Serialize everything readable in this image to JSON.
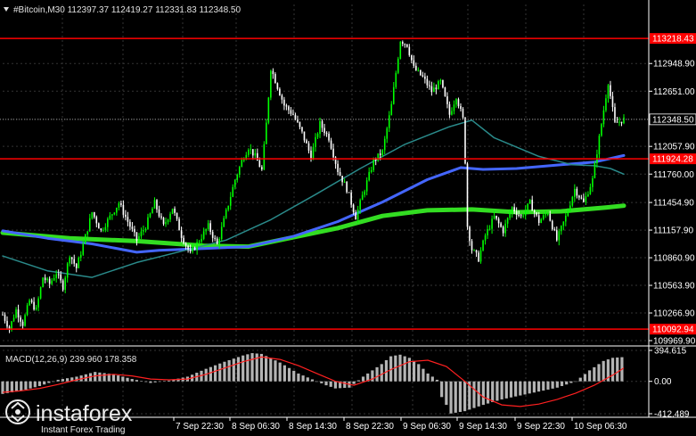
{
  "header": {
    "main_label": "#Bitcoin,M30  112397.37 112419.27 112331.83 112348.50",
    "macd_label": "MACD(12,26,9) 239.960 178.358"
  },
  "watermark": {
    "brand": "instaforex",
    "tagline": "Instant Forex Trading"
  },
  "colors": {
    "background": "#000000",
    "grid": "#343434",
    "bull": "#00ff00",
    "bear": "#ffffff",
    "hline": "#ff0000",
    "ma_slow": "#33dd22",
    "ma_mid": "#4466ff",
    "ma_fast": "#2a8a8a",
    "macd_hist": "#b4b4b4",
    "macd_signal": "#ff2020",
    "current_label_bg": "#000000"
  },
  "chart_data": [
    {
      "type": "candlestick",
      "symbol": "#Bitcoin",
      "timeframe": "M30",
      "ylim": [
        109969.9,
        113440
      ],
      "y_ticks": [
        112948.9,
        112651.0,
        112348.5,
        112057.9,
        111760.0,
        111454.9,
        111157.9,
        110860.9,
        110563.9,
        110266.9,
        109969.9
      ],
      "y_tick_labels": [
        "112948.90",
        "112651.00",
        "112348.50",
        "112057.90",
        "111760.00",
        "111454.90",
        "111157.90",
        "110860.90",
        "110563.90",
        "110266.90",
        "109969.90"
      ],
      "x_tick_labels": [
        "7 Sep 22:30",
        "8 Sep 06:30",
        "8 Sep 14:30",
        "8 Sep 22:30",
        "9 Sep 06:30",
        "9 Sep 14:30",
        "9 Sep 22:30",
        "10 Sep 06:30"
      ],
      "horizontal_lines": [
        {
          "value": 113218.43,
          "label": "113218.43"
        },
        {
          "value": 111924.28,
          "label": "111924.28"
        },
        {
          "value": 110092.94,
          "label": "110092.94"
        }
      ],
      "current_price": {
        "value": 112348.5,
        "label": "112348.50"
      },
      "price_path": [
        [
          0,
          110250
        ],
        [
          3,
          110100
        ],
        [
          6,
          110300
        ],
        [
          9,
          110150
        ],
        [
          12,
          110400
        ],
        [
          15,
          110300
        ],
        [
          18,
          110650
        ],
        [
          21,
          110580
        ],
        [
          24,
          110700
        ],
        [
          27,
          110550
        ],
        [
          30,
          110900
        ],
        [
          33,
          110750
        ],
        [
          36,
          111000
        ],
        [
          40,
          111350
        ],
        [
          44,
          111150
        ],
        [
          48,
          111300
        ],
        [
          52,
          111450
        ],
        [
          56,
          111250
        ],
        [
          60,
          111050
        ],
        [
          64,
          111200
        ],
        [
          68,
          111450
        ],
        [
          72,
          111200
        ],
        [
          76,
          111400
        ],
        [
          80,
          111100
        ],
        [
          84,
          110900
        ],
        [
          88,
          111050
        ],
        [
          92,
          111200
        ],
        [
          96,
          111000
        ],
        [
          100,
          111350
        ],
        [
          104,
          111700
        ],
        [
          107,
          111900
        ],
        [
          110,
          112050
        ],
        [
          113,
          111950
        ],
        [
          116,
          111800
        ],
        [
          118,
          112300
        ],
        [
          120,
          112900
        ],
        [
          123,
          112700
        ],
        [
          126,
          112500
        ],
        [
          130,
          112400
        ],
        [
          134,
          112200
        ],
        [
          138,
          111950
        ],
        [
          142,
          112300
        ],
        [
          146,
          112150
        ],
        [
          150,
          111800
        ],
        [
          154,
          111600
        ],
        [
          158,
          111300
        ],
        [
          162,
          111600
        ],
        [
          166,
          111900
        ],
        [
          170,
          112000
        ],
        [
          174,
          112500
        ],
        [
          178,
          113200
        ],
        [
          181,
          113150
        ],
        [
          184,
          112900
        ],
        [
          188,
          112800
        ],
        [
          192,
          112650
        ],
        [
          196,
          112750
        ],
        [
          200,
          112400
        ],
        [
          203,
          112600
        ],
        [
          206,
          112350
        ],
        [
          207,
          111900
        ],
        [
          208,
          111200
        ],
        [
          210,
          110950
        ],
        [
          213,
          110850
        ],
        [
          216,
          111100
        ],
        [
          220,
          111300
        ],
        [
          224,
          111150
        ],
        [
          228,
          111400
        ],
        [
          232,
          111300
        ],
        [
          236,
          111450
        ],
        [
          240,
          111250
        ],
        [
          244,
          111350
        ],
        [
          248,
          111050
        ],
        [
          252,
          111300
        ],
        [
          256,
          111600
        ],
        [
          260,
          111450
        ],
        [
          264,
          111700
        ],
        [
          268,
          112300
        ],
        [
          271,
          112750
        ],
        [
          274,
          112300
        ],
        [
          278,
          112350
        ]
      ],
      "series": [
        {
          "values": [
            [
              0,
              111130
            ],
            [
              30,
              111070
            ],
            [
              60,
              111040
            ],
            [
              90,
              110990
            ],
            [
              110,
              110980
            ],
            [
              130,
              111080
            ],
            [
              150,
              111180
            ],
            [
              170,
              111310
            ],
            [
              190,
              111370
            ],
            [
              210,
              111380
            ],
            [
              230,
              111350
            ],
            [
              250,
              111360
            ],
            [
              270,
              111400
            ],
            [
              278,
              111420
            ]
          ]
        },
        {
          "values": [
            [
              0,
              111150
            ],
            [
              20,
              111070
            ],
            [
              40,
              111010
            ],
            [
              60,
              110920
            ],
            [
              70,
              110940
            ],
            [
              90,
              110960
            ],
            [
              110,
              110980
            ],
            [
              130,
              111090
            ],
            [
              150,
              111250
            ],
            [
              170,
              111460
            ],
            [
              190,
              111700
            ],
            [
              205,
              111830
            ],
            [
              215,
              111810
            ],
            [
              230,
              111820
            ],
            [
              250,
              111860
            ],
            [
              265,
              111890
            ],
            [
              278,
              111960
            ]
          ]
        },
        {
          "values": [
            [
              0,
              110880
            ],
            [
              20,
              110720
            ],
            [
              40,
              110650
            ],
            [
              60,
              110810
            ],
            [
              80,
              110930
            ],
            [
              100,
              111050
            ],
            [
              120,
              111270
            ],
            [
              140,
              111540
            ],
            [
              160,
              111820
            ],
            [
              180,
              112080
            ],
            [
              200,
              112270
            ],
            [
              210,
              112340
            ],
            [
              220,
              112150
            ],
            [
              240,
              111950
            ],
            [
              255,
              111860
            ],
            [
              265,
              111850
            ],
            [
              272,
              111820
            ],
            [
              278,
              111760
            ]
          ]
        }
      ]
    },
    {
      "type": "bar",
      "indicator": "MACD(12,26,9)",
      "ylim": [
        -412.489,
        394.615
      ],
      "y_tick_labels": [
        "394.615",
        "0.00",
        "-412.489"
      ],
      "histogram": [
        [
          0,
          -160
        ],
        [
          20,
          -120
        ],
        [
          40,
          -60
        ],
        [
          60,
          20
        ],
        [
          80,
          60
        ],
        [
          100,
          120
        ],
        [
          120,
          90
        ],
        [
          140,
          30
        ],
        [
          160,
          -20
        ],
        [
          180,
          10
        ],
        [
          200,
          60
        ],
        [
          220,
          160
        ],
        [
          240,
          250
        ],
        [
          260,
          330
        ],
        [
          270,
          360
        ],
        [
          280,
          350
        ],
        [
          300,
          240
        ],
        [
          320,
          100
        ],
        [
          340,
          0
        ],
        [
          350,
          -50
        ],
        [
          360,
          -90
        ],
        [
          375,
          -80
        ],
        [
          390,
          60
        ],
        [
          400,
          140
        ],
        [
          410,
          220
        ],
        [
          420,
          320
        ],
        [
          430,
          340
        ],
        [
          440,
          300
        ],
        [
          450,
          220
        ],
        [
          460,
          100
        ],
        [
          470,
          20
        ],
        [
          475,
          -200
        ],
        [
          480,
          -300
        ],
        [
          485,
          -410
        ],
        [
          500,
          -380
        ],
        [
          520,
          -300
        ],
        [
          540,
          -230
        ],
        [
          560,
          -180
        ],
        [
          580,
          -130
        ],
        [
          600,
          -80
        ],
        [
          620,
          0
        ],
        [
          635,
          140
        ],
        [
          650,
          260
        ],
        [
          660,
          300
        ],
        [
          672,
          310
        ]
      ],
      "signal": [
        [
          0,
          -140
        ],
        [
          20,
          -120
        ],
        [
          40,
          -90
        ],
        [
          60,
          -40
        ],
        [
          80,
          20
        ],
        [
          100,
          70
        ],
        [
          120,
          90
        ],
        [
          140,
          70
        ],
        [
          160,
          30
        ],
        [
          180,
          20
        ],
        [
          200,
          30
        ],
        [
          220,
          90
        ],
        [
          240,
          170
        ],
        [
          260,
          250
        ],
        [
          280,
          310
        ],
        [
          300,
          280
        ],
        [
          320,
          200
        ],
        [
          340,
          100
        ],
        [
          360,
          0
        ],
        [
          380,
          -50
        ],
        [
          400,
          30
        ],
        [
          420,
          150
        ],
        [
          440,
          250
        ],
        [
          460,
          270
        ],
        [
          480,
          190
        ],
        [
          500,
          0
        ],
        [
          520,
          -200
        ],
        [
          540,
          -300
        ],
        [
          560,
          -320
        ],
        [
          580,
          -290
        ],
        [
          600,
          -230
        ],
        [
          620,
          -150
        ],
        [
          640,
          -50
        ],
        [
          660,
          80
        ],
        [
          672,
          170
        ]
      ]
    }
  ]
}
